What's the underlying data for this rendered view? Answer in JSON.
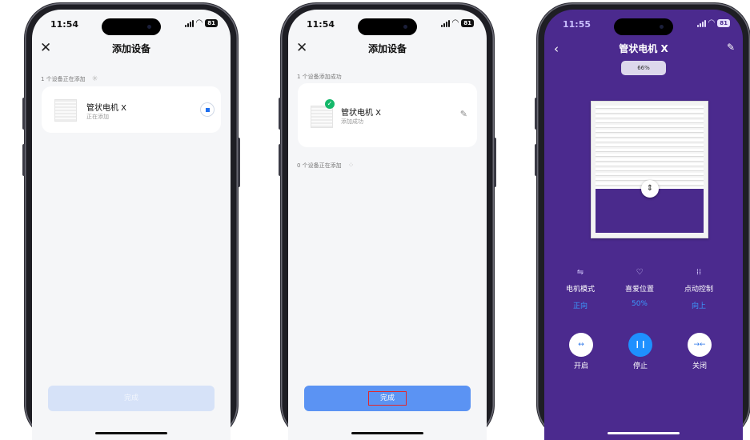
{
  "phone1": {
    "time": "11:54",
    "battery": "81",
    "title": "添加设备",
    "section": "1 个设备正在添加",
    "device": {
      "name": "管状电机 X",
      "status": "正在添加"
    },
    "button": "完成",
    "button_color": "#d6e2f8"
  },
  "phone2": {
    "time": "11:54",
    "battery": "81",
    "title": "添加设备",
    "section_success": "1 个设备添加成功",
    "device": {
      "name": "管状电机 X",
      "status": "添加成功"
    },
    "section_adding": "0 个设备正在添加",
    "button": "完成",
    "button_color": "#5b93f3"
  },
  "phone3": {
    "time": "11:55",
    "battery": "81",
    "title": "管状电机 X",
    "percent": "66%",
    "curtain_closed_fraction": 0.66,
    "controls": [
      {
        "icon": "sliders-icon",
        "label": "电机模式",
        "value": "正向"
      },
      {
        "icon": "heart-icon",
        "label": "喜爱位置",
        "value": "50%"
      },
      {
        "icon": "grid-icon",
        "label": "点动控制",
        "value": "向上"
      }
    ],
    "actions": [
      {
        "icon": "open-arrows-icon",
        "label": "开启"
      },
      {
        "icon": "pause-icon",
        "label": "停止"
      },
      {
        "icon": "close-arrows-icon",
        "label": "关闭"
      }
    ],
    "background": "#4b2a8e",
    "accent": "#1e90ff"
  }
}
